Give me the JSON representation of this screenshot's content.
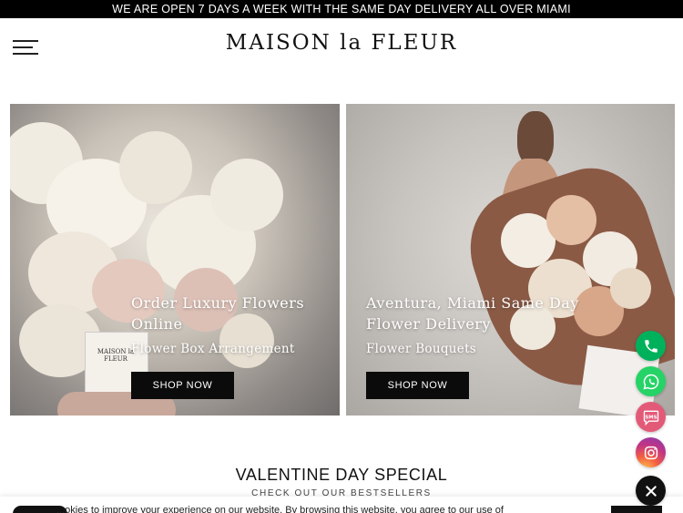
{
  "announcement": "WE ARE OPEN 7 DAYS A WEEK WITH THE SAME DAY DELIVERY ALL OVER MIAMI",
  "header": {
    "logo": "MAISON la FLEUR",
    "menu_icon": "hamburger-menu-icon"
  },
  "panels": [
    {
      "title_line1": "Order Luxury Flowers",
      "title_line2": "Online",
      "subtitle": "Flower Box Arrangement",
      "button": "SHOP NOW",
      "box_label": "MAISON la FLEUR"
    },
    {
      "title_line1": "Aventura, Miami Same Day",
      "title_line2": "Flower Delivery",
      "subtitle": "Flower Bouquets",
      "button": "SHOP NOW"
    }
  ],
  "section": {
    "title": "VALENTINE DAY SPECIAL",
    "subtitle": "CHECK OUT OUR BESTSELLERS"
  },
  "cookie": {
    "text": "...okies to improve your experience on our website. By browsing this website, you agree to our use of"
  },
  "floating_buttons": {
    "phone": "phone-icon",
    "whatsapp": "whatsapp-icon",
    "sms": "SMS",
    "instagram": "instagram-icon",
    "close": "close-icon"
  },
  "colors": {
    "accent_black": "#0b0b0b",
    "phone_green": "#00b15c",
    "whatsapp_green": "#25d366",
    "sms_pink": "#e35a78"
  }
}
